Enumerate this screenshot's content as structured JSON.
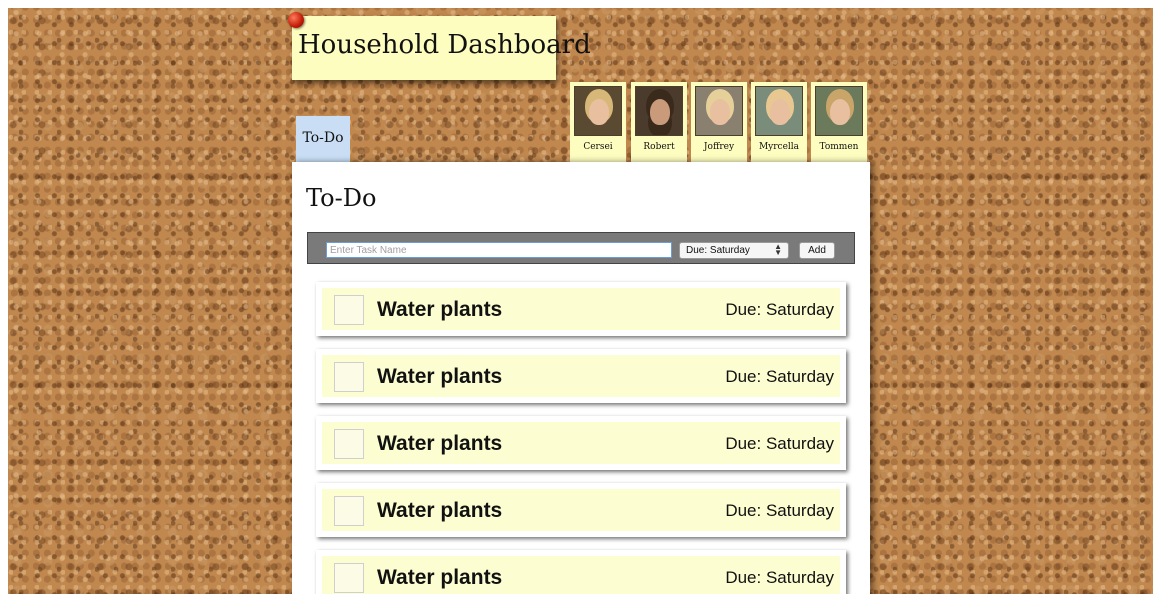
{
  "app": {
    "title": "Household Dashboard"
  },
  "tabs": {
    "todo_label": "To-Do"
  },
  "family": [
    {
      "name": "Cersei",
      "hair": "#d8b878",
      "bg": "#5a4a32"
    },
    {
      "name": "Robert",
      "hair": "#3a2a1c",
      "bg": "#4a3b2c"
    },
    {
      "name": "Joffrey",
      "hair": "#e6d09a",
      "bg": "#8a8070"
    },
    {
      "name": "Myrcella",
      "hair": "#e8c890",
      "bg": "#7a8c7a"
    },
    {
      "name": "Tommen",
      "hair": "#c9a56a",
      "bg": "#6a7a5a"
    }
  ],
  "panel": {
    "title": "To-Do",
    "input_placeholder": "Enter Task Name",
    "due_selected": "Due: Saturday",
    "add_label": "Add"
  },
  "tasks": [
    {
      "name": "Water plants",
      "due": "Due: Saturday"
    },
    {
      "name": "Water plants",
      "due": "Due: Saturday"
    },
    {
      "name": "Water plants",
      "due": "Due: Saturday"
    },
    {
      "name": "Water plants",
      "due": "Due: Saturday"
    },
    {
      "name": "Water plants",
      "due": "Due: Saturday"
    }
  ]
}
